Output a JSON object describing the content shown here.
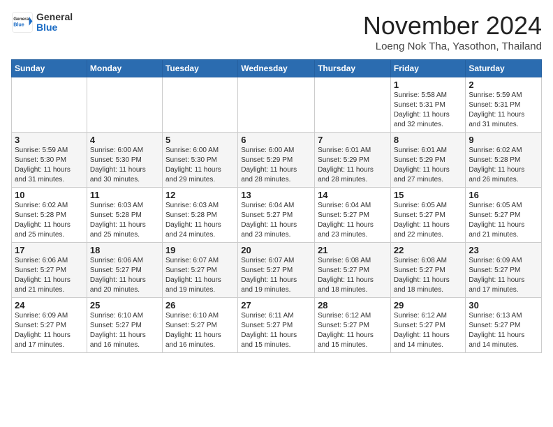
{
  "header": {
    "logo": {
      "general": "General",
      "blue": "Blue"
    },
    "month": "November 2024",
    "location": "Loeng Nok Tha, Yasothon, Thailand"
  },
  "days_of_week": [
    "Sunday",
    "Monday",
    "Tuesday",
    "Wednesday",
    "Thursday",
    "Friday",
    "Saturday"
  ],
  "weeks": [
    [
      {
        "day": "",
        "info": ""
      },
      {
        "day": "",
        "info": ""
      },
      {
        "day": "",
        "info": ""
      },
      {
        "day": "",
        "info": ""
      },
      {
        "day": "",
        "info": ""
      },
      {
        "day": "1",
        "info": "Sunrise: 5:58 AM\nSunset: 5:31 PM\nDaylight: 11 hours\nand 32 minutes."
      },
      {
        "day": "2",
        "info": "Sunrise: 5:59 AM\nSunset: 5:31 PM\nDaylight: 11 hours\nand 31 minutes."
      }
    ],
    [
      {
        "day": "3",
        "info": "Sunrise: 5:59 AM\nSunset: 5:30 PM\nDaylight: 11 hours\nand 31 minutes."
      },
      {
        "day": "4",
        "info": "Sunrise: 6:00 AM\nSunset: 5:30 PM\nDaylight: 11 hours\nand 30 minutes."
      },
      {
        "day": "5",
        "info": "Sunrise: 6:00 AM\nSunset: 5:30 PM\nDaylight: 11 hours\nand 29 minutes."
      },
      {
        "day": "6",
        "info": "Sunrise: 6:00 AM\nSunset: 5:29 PM\nDaylight: 11 hours\nand 28 minutes."
      },
      {
        "day": "7",
        "info": "Sunrise: 6:01 AM\nSunset: 5:29 PM\nDaylight: 11 hours\nand 28 minutes."
      },
      {
        "day": "8",
        "info": "Sunrise: 6:01 AM\nSunset: 5:29 PM\nDaylight: 11 hours\nand 27 minutes."
      },
      {
        "day": "9",
        "info": "Sunrise: 6:02 AM\nSunset: 5:28 PM\nDaylight: 11 hours\nand 26 minutes."
      }
    ],
    [
      {
        "day": "10",
        "info": "Sunrise: 6:02 AM\nSunset: 5:28 PM\nDaylight: 11 hours\nand 25 minutes."
      },
      {
        "day": "11",
        "info": "Sunrise: 6:03 AM\nSunset: 5:28 PM\nDaylight: 11 hours\nand 25 minutes."
      },
      {
        "day": "12",
        "info": "Sunrise: 6:03 AM\nSunset: 5:28 PM\nDaylight: 11 hours\nand 24 minutes."
      },
      {
        "day": "13",
        "info": "Sunrise: 6:04 AM\nSunset: 5:27 PM\nDaylight: 11 hours\nand 23 minutes."
      },
      {
        "day": "14",
        "info": "Sunrise: 6:04 AM\nSunset: 5:27 PM\nDaylight: 11 hours\nand 23 minutes."
      },
      {
        "day": "15",
        "info": "Sunrise: 6:05 AM\nSunset: 5:27 PM\nDaylight: 11 hours\nand 22 minutes."
      },
      {
        "day": "16",
        "info": "Sunrise: 6:05 AM\nSunset: 5:27 PM\nDaylight: 11 hours\nand 21 minutes."
      }
    ],
    [
      {
        "day": "17",
        "info": "Sunrise: 6:06 AM\nSunset: 5:27 PM\nDaylight: 11 hours\nand 21 minutes."
      },
      {
        "day": "18",
        "info": "Sunrise: 6:06 AM\nSunset: 5:27 PM\nDaylight: 11 hours\nand 20 minutes."
      },
      {
        "day": "19",
        "info": "Sunrise: 6:07 AM\nSunset: 5:27 PM\nDaylight: 11 hours\nand 19 minutes."
      },
      {
        "day": "20",
        "info": "Sunrise: 6:07 AM\nSunset: 5:27 PM\nDaylight: 11 hours\nand 19 minutes."
      },
      {
        "day": "21",
        "info": "Sunrise: 6:08 AM\nSunset: 5:27 PM\nDaylight: 11 hours\nand 18 minutes."
      },
      {
        "day": "22",
        "info": "Sunrise: 6:08 AM\nSunset: 5:27 PM\nDaylight: 11 hours\nand 18 minutes."
      },
      {
        "day": "23",
        "info": "Sunrise: 6:09 AM\nSunset: 5:27 PM\nDaylight: 11 hours\nand 17 minutes."
      }
    ],
    [
      {
        "day": "24",
        "info": "Sunrise: 6:09 AM\nSunset: 5:27 PM\nDaylight: 11 hours\nand 17 minutes."
      },
      {
        "day": "25",
        "info": "Sunrise: 6:10 AM\nSunset: 5:27 PM\nDaylight: 11 hours\nand 16 minutes."
      },
      {
        "day": "26",
        "info": "Sunrise: 6:10 AM\nSunset: 5:27 PM\nDaylight: 11 hours\nand 16 minutes."
      },
      {
        "day": "27",
        "info": "Sunrise: 6:11 AM\nSunset: 5:27 PM\nDaylight: 11 hours\nand 15 minutes."
      },
      {
        "day": "28",
        "info": "Sunrise: 6:12 AM\nSunset: 5:27 PM\nDaylight: 11 hours\nand 15 minutes."
      },
      {
        "day": "29",
        "info": "Sunrise: 6:12 AM\nSunset: 5:27 PM\nDaylight: 11 hours\nand 14 minutes."
      },
      {
        "day": "30",
        "info": "Sunrise: 6:13 AM\nSunset: 5:27 PM\nDaylight: 11 hours\nand 14 minutes."
      }
    ]
  ]
}
